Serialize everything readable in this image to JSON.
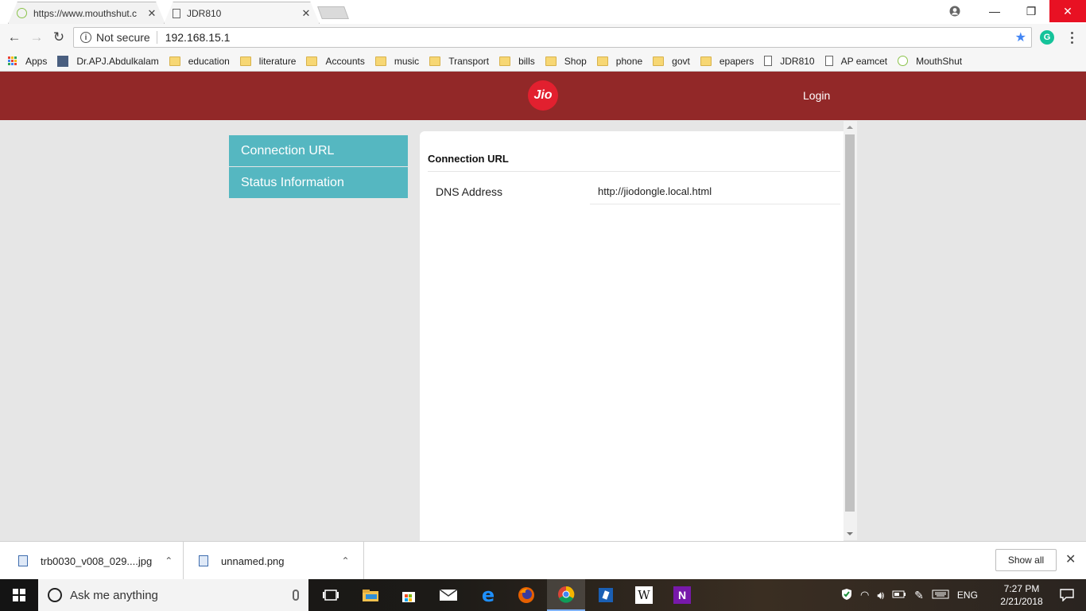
{
  "browser": {
    "tabs": [
      {
        "title": "https://www.mouthshut.c",
        "favicon": "mouthshut-icon"
      },
      {
        "title": "JDR810",
        "favicon": "page-icon"
      }
    ],
    "security_label": "Not secure",
    "url": "192.168.15.1",
    "extension_letter": "G",
    "bookmarks": [
      {
        "label": "Apps",
        "icon": "apps-icon"
      },
      {
        "label": "Dr.APJ.Abdulkalam",
        "icon": "avatar-icon"
      },
      {
        "label": "education",
        "icon": "folder-icon"
      },
      {
        "label": "literature",
        "icon": "folder-icon"
      },
      {
        "label": "Accounts",
        "icon": "folder-icon"
      },
      {
        "label": "music",
        "icon": "folder-icon"
      },
      {
        "label": "Transport",
        "icon": "folder-icon"
      },
      {
        "label": "bills",
        "icon": "folder-icon"
      },
      {
        "label": "Shop",
        "icon": "folder-icon"
      },
      {
        "label": "phone",
        "icon": "folder-icon"
      },
      {
        "label": "govt",
        "icon": "folder-icon"
      },
      {
        "label": "epapers",
        "icon": "folder-icon"
      },
      {
        "label": "JDR810",
        "icon": "page-icon"
      },
      {
        "label": "AP eamcet",
        "icon": "page-icon"
      },
      {
        "label": "MouthShut",
        "icon": "mouthshut-icon"
      }
    ]
  },
  "header": {
    "logo_text": "Jio",
    "login_label": "Login",
    "color": "#922828"
  },
  "sidebar": {
    "items": [
      {
        "label": "Connection URL"
      },
      {
        "label": "Status Information"
      }
    ],
    "color": "#55b7c1"
  },
  "main": {
    "title": "Connection URL",
    "rows": [
      {
        "label": "DNS Address",
        "value": "http://jiodongle.local.html"
      }
    ]
  },
  "downloads": {
    "items": [
      {
        "name": "trb0030_v008_029....jpg"
      },
      {
        "name": "unnamed.png"
      }
    ],
    "show_all_label": "Show all"
  },
  "taskbar": {
    "search_placeholder": "Ask me anything",
    "language": "ENG",
    "time": "7:27 PM",
    "date": "2/21/2018"
  }
}
